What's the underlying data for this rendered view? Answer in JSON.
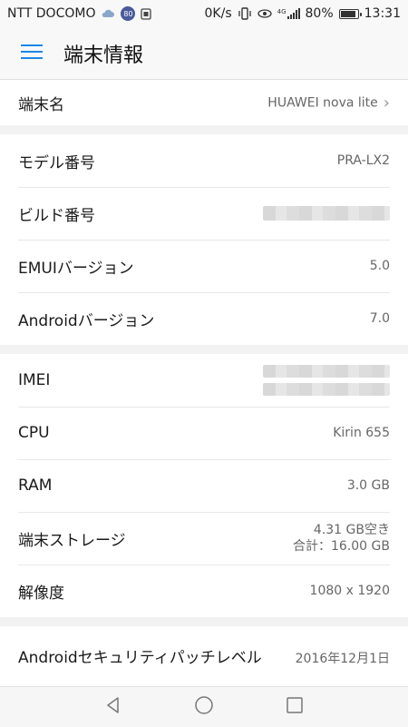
{
  "status_bar": {
    "carrier": "NTT DOCOMO",
    "badge": "80",
    "speed": "0K/s",
    "network": "4G",
    "battery": "80%",
    "time": "13:31"
  },
  "header": {
    "title": "端末情報"
  },
  "sections": [
    {
      "rows": [
        {
          "label": "端末名",
          "value": "HUAWEI nova lite"
        }
      ]
    },
    {
      "rows": [
        {
          "label": "モデル番号",
          "value": "PRA-LX2"
        },
        {
          "label": "ビルド番号"
        },
        {
          "label": "EMUIバージョン",
          "value": "5.0"
        },
        {
          "label": "Androidバージョン",
          "value": "7.0"
        }
      ]
    },
    {
      "rows": [
        {
          "label": "IMEI"
        },
        {
          "label": "CPU",
          "value": "Kirin 655"
        },
        {
          "label": "RAM",
          "value": "3.0 GB"
        },
        {
          "label": "端末ストレージ",
          "value_line1": "4.31  GB空き",
          "value_line2": "合計：16.00  GB"
        },
        {
          "label": "解像度",
          "value": "1080 x 1920"
        }
      ]
    },
    {
      "rows": [
        {
          "label": "Androidセキュリティパッチレベル",
          "value": "2016年12月1日"
        }
      ]
    }
  ],
  "icons": {
    "menu": "hamburger-icon",
    "chevron": "chevron-right-icon",
    "back": "back-triangle-icon",
    "home": "home-circle-icon",
    "recents": "recents-square-icon"
  },
  "colors": {
    "accent": "#1e88e5",
    "background": "#f2f2f2",
    "card": "#ffffff"
  }
}
